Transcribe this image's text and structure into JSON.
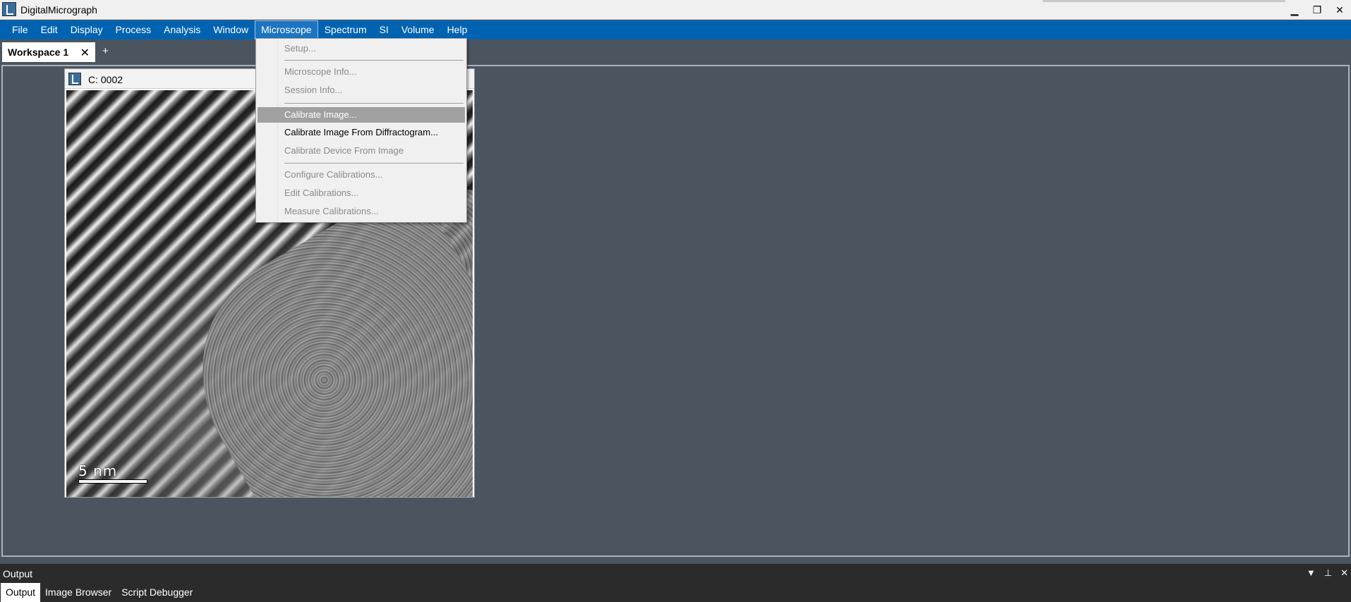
{
  "window": {
    "title": "DigitalMicrograph",
    "minimize_label": "▁",
    "restore_label": "❐",
    "close_label": "✕"
  },
  "menubar": {
    "items": [
      "File",
      "Edit",
      "Display",
      "Process",
      "Analysis",
      "Window",
      "Microscope",
      "Spectrum",
      "SI",
      "Volume",
      "Help"
    ],
    "active": "Microscope"
  },
  "workspace_tabs": {
    "active_label": "Workspace 1",
    "close_label": "✕",
    "add_label": "+"
  },
  "image_window": {
    "title": "C: 0002",
    "scalebar_label": "5 nm"
  },
  "microscope_menu": {
    "items": [
      {
        "label": "Setup...",
        "enabled": false
      },
      {
        "label": "Microscope Info...",
        "enabled": false
      },
      {
        "label": "Session Info...",
        "enabled": false
      },
      {
        "label": "Calibrate Image...",
        "enabled": true,
        "highlighted": true
      },
      {
        "label": "Calibrate Image From Diffractogram...",
        "enabled": true
      },
      {
        "label": "Calibrate Device From Image",
        "enabled": false
      },
      {
        "label": "Configure Calibrations...",
        "enabled": false
      },
      {
        "label": "Edit Calibrations...",
        "enabled": false
      },
      {
        "label": "Measure Calibrations...",
        "enabled": false
      }
    ]
  },
  "output_panel": {
    "title": "Output",
    "dropdown_icon": "▼",
    "pin_icon": "⊥",
    "close_icon": "✕",
    "tabs": [
      "Output",
      "Image Browser",
      "Script Debugger"
    ],
    "active_tab": "Output"
  },
  "colors": {
    "menubar": "#0063b1",
    "workspace": "#4a5560",
    "menu_highlight": "#a0a0a0"
  }
}
